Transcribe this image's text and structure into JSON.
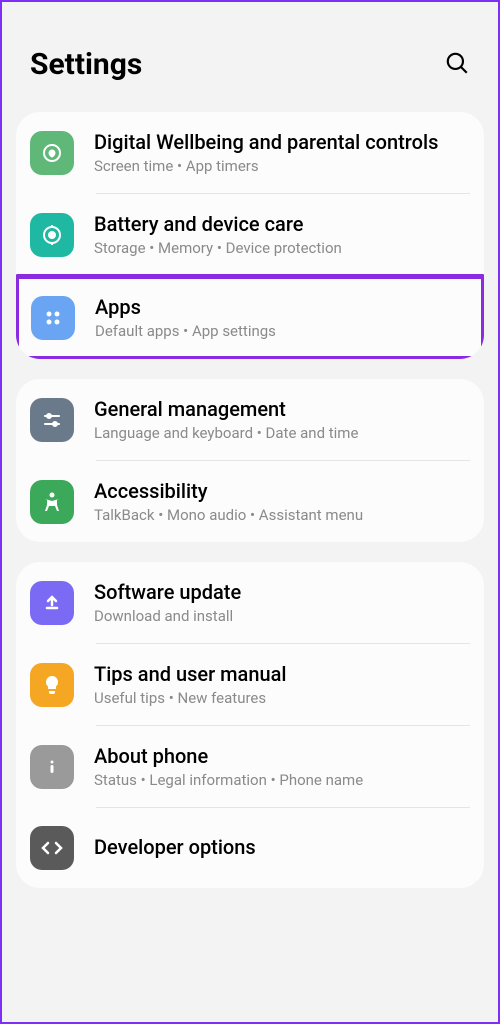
{
  "header": {
    "title": "Settings"
  },
  "groups": [
    {
      "items": [
        {
          "title": "Digital Wellbeing and parental controls",
          "sub": "Screen time  •  App timers"
        },
        {
          "title": "Battery and device care",
          "sub": "Storage  •  Memory  •  Device protection"
        },
        {
          "title": "Apps",
          "sub": "Default apps  •  App settings",
          "highlighted": true
        }
      ]
    },
    {
      "items": [
        {
          "title": "General management",
          "sub": "Language and keyboard  •  Date and time"
        },
        {
          "title": "Accessibility",
          "sub": "TalkBack  •  Mono audio  •  Assistant menu"
        }
      ]
    },
    {
      "items": [
        {
          "title": "Software update",
          "sub": "Download and install"
        },
        {
          "title": "Tips and user manual",
          "sub": "Useful tips  •  New features"
        },
        {
          "title": "About phone",
          "sub": "Status  •  Legal information  •  Phone name"
        },
        {
          "title": "Developer options",
          "sub": ""
        }
      ]
    }
  ]
}
